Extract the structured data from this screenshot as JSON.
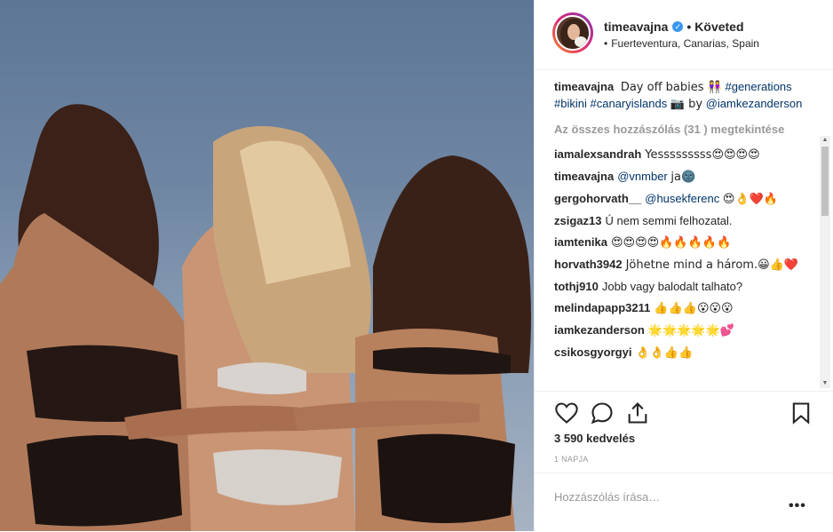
{
  "header": {
    "username": "timeavajna",
    "verified_mark": "✓",
    "separator": "•",
    "follow_state": "Követed",
    "location": "Fuerteventura, Canarias, Spain"
  },
  "caption": {
    "username": "timeavajna",
    "text_1": "Day off babies 👭",
    "tag_generations": "#generations",
    "tag_bikini": "#bikini",
    "tag_canary": "#canaryislands",
    "text_2": "📷 by",
    "mention": "@iamkezanderson"
  },
  "view_all": "Az összes hozzászólás (31 ) megtekintése",
  "comments": [
    {
      "username": "iamalexsandrah",
      "text": "Yesssssssss😍😍😍😍"
    },
    {
      "username": "timeavajna",
      "mention": "@vnmber",
      "text": "ja🌚"
    },
    {
      "username": "gergohorvath__",
      "mention": "@husekferenc",
      "text": "😍👌❤️🔥"
    },
    {
      "username": "zsigaz13",
      "text": "Ú nem semmi felhozatal."
    },
    {
      "username": "iamtenika",
      "text": "😍😍😍😍🔥🔥🔥🔥🔥"
    },
    {
      "username": "horvath3942",
      "text": "Jöhetne mind a három.😀👍❤️"
    },
    {
      "username": "tothj910",
      "text": "Jobb vagy balodalt talhato?"
    },
    {
      "username": "melindapapp3211",
      "text": "👍👍👍😮😮😮"
    },
    {
      "username": "iamkezanderson",
      "text": "🌟🌟🌟🌟🌟💕"
    },
    {
      "username": "csikosgyorgyi",
      "text": "👌👌👍👍"
    }
  ],
  "likes": "3 590 kedvelés",
  "time_ago": "1 NAPJA",
  "comment_box": {
    "placeholder": "Hozzászólás írása…",
    "more": "•••"
  },
  "icons": [
    "heart-icon",
    "comment-icon",
    "share-icon",
    "bookmark-icon"
  ],
  "colors": {
    "link": "#003569",
    "verified": "#3897f0",
    "muted": "#999999"
  }
}
